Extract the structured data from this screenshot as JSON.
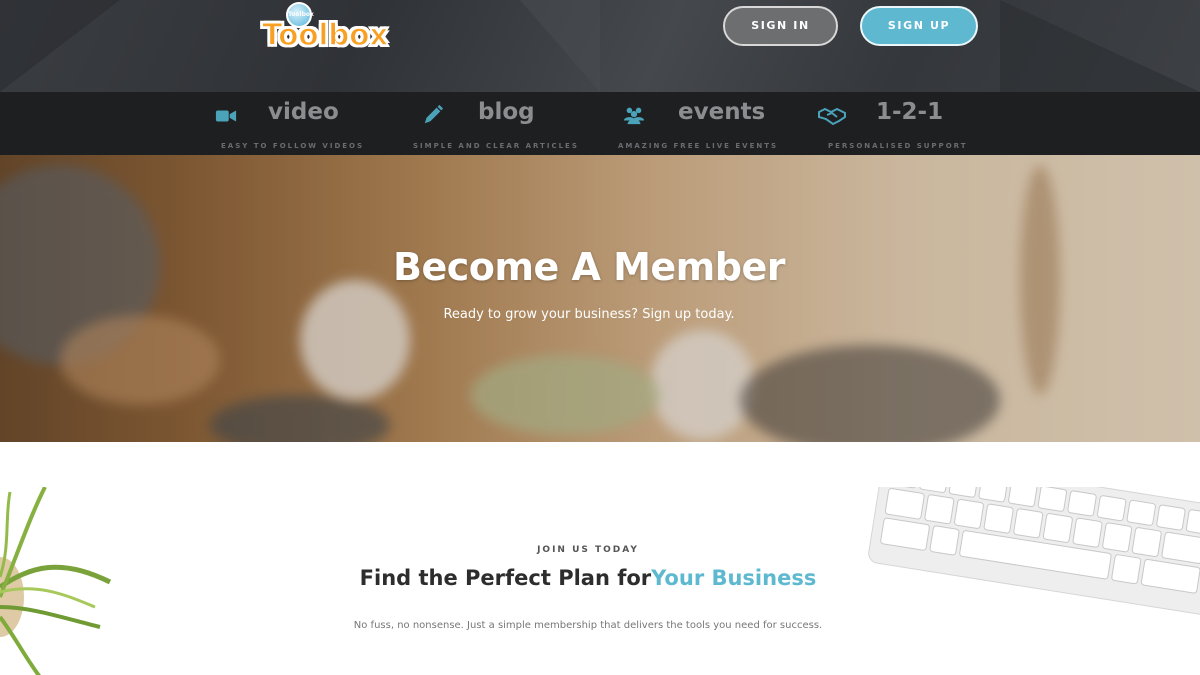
{
  "brand": {
    "logo_text": "Toolbox",
    "badge_text": "Toolbox"
  },
  "auth": {
    "signin_label": "SIGN IN",
    "signup_label": "SIGN UP"
  },
  "features": [
    {
      "icon": "video-camera-icon",
      "title": "video",
      "subtitle": "EASY TO FOLLOW VIDEOS"
    },
    {
      "icon": "pencil-icon",
      "title": "blog",
      "subtitle": "SIMPLE AND CLEAR ARTICLES"
    },
    {
      "icon": "users-icon",
      "title": "events",
      "subtitle": "AMAZING FREE LIVE EVENTS"
    },
    {
      "icon": "handshake-icon",
      "title": "1-2-1",
      "subtitle": "PERSONALISED SUPPORT"
    }
  ],
  "hero": {
    "title": "Become A Member",
    "subtitle": "Ready to grow your business? Sign up today."
  },
  "plans": {
    "eyebrow": "JOIN US TODAY",
    "title_main": "Find the Perfect Plan for",
    "title_accent": "Your Business",
    "description": "No fuss, no nonsense. Just a simple membership that delivers the tools you need for success."
  },
  "colors": {
    "accent": "#5db8d0",
    "brand_orange": "#f7a024",
    "header_bg": "#3a3d41",
    "features_bg": "#1e1f21",
    "feature_icon": "#4aa3b8"
  }
}
